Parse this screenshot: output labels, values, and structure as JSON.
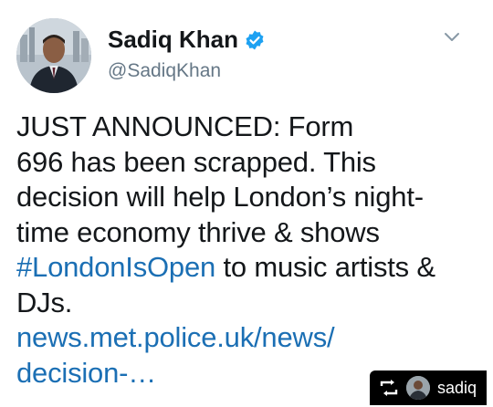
{
  "author": {
    "name": "Sadiq Khan",
    "handle": "@SadiqKhan",
    "verified_icon": "verified-badge-icon",
    "verified_color": "#1da1f2"
  },
  "menu": {
    "icon": "chevron-down-icon"
  },
  "tweet": {
    "line1": "JUST ANNOUNCED: Form",
    "line2": "696 has been scrapped. This",
    "line3": "decision will help London’s night-",
    "line4": "time economy thrive & shows",
    "hashtag": "#LondonIsOpen",
    "line5_rest": " to music artists &",
    "line6": "DJs.",
    "link_line1": "news.met.police.uk/news/",
    "link_line2": "decision-…",
    "link_color": "#1b6fb4"
  },
  "repost": {
    "icon": "repost-icon",
    "username": "sadiq"
  }
}
